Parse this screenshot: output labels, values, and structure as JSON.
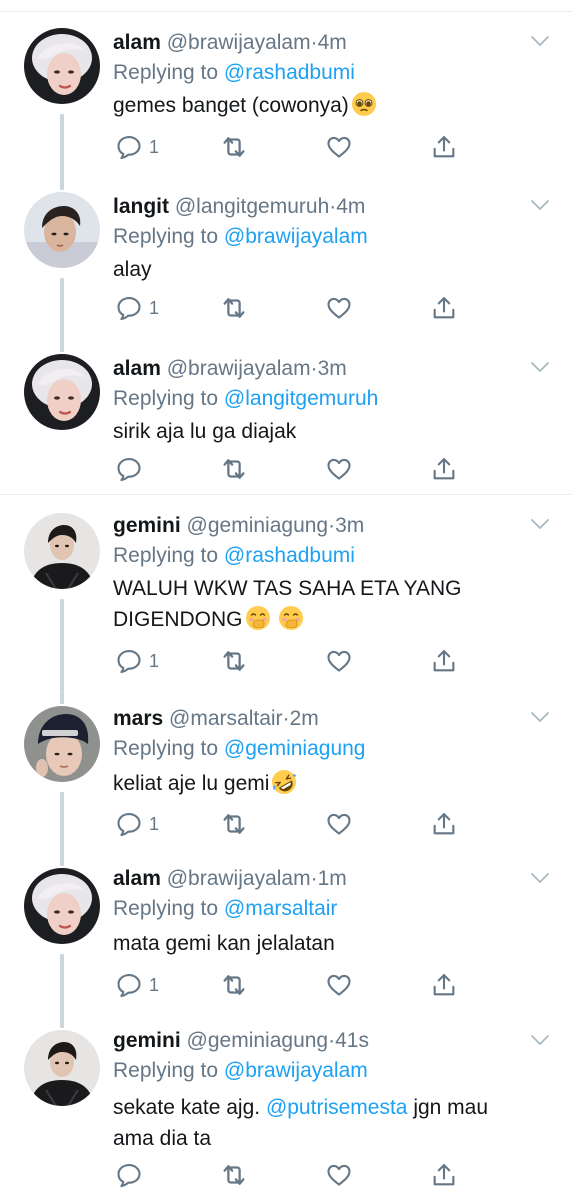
{
  "colors": {
    "link": "#1da1f2",
    "muted": "#657786",
    "text": "#14171a",
    "thread_line": "#ccd6dd",
    "divider": "#e6ecf0"
  },
  "labels": {
    "replying_to": "Replying to"
  },
  "tweets": [
    {
      "name": "alam",
      "handle": "@brawijayalam",
      "sep": "·",
      "time": "4m",
      "reply_to": "@rashadbumi",
      "text": "gemes banget (cowonya)",
      "emoji": "pleading-face-emoji",
      "reply_count": "1"
    },
    {
      "name": "langit",
      "handle": "@langitgemuruh",
      "sep": "·",
      "time": "4m",
      "reply_to": "@brawijayalam",
      "text": "alay",
      "reply_count": "1"
    },
    {
      "name": "alam",
      "handle": "@brawijayalam",
      "sep": "·",
      "time": "3m",
      "reply_to": "@langitgemuruh",
      "text": "sirik aja lu ga diajak",
      "reply_count": ""
    },
    {
      "name": "gemini",
      "handle": "@geminiagung",
      "sep": "·",
      "time": "3m",
      "reply_to": "@rashadbumi",
      "text_line1": "WALUH WKW TAS SAHA ETA YANG",
      "text_line2": "DIGENDONG",
      "emoji": "hand-over-mouth-emoji",
      "reply_count": "1"
    },
    {
      "name": "mars",
      "handle": "@marsaltair",
      "sep": "·",
      "time": "2m",
      "reply_to": "@geminiagung",
      "text": "keliat aje lu gemi",
      "emoji": "rolling-on-floor-laughing-emoji",
      "reply_count": "1"
    },
    {
      "name": "alam",
      "handle": "@brawijayalam",
      "sep": "·",
      "time": "1m",
      "reply_to": "@marsaltair",
      "text": "mata gemi kan jelalatan",
      "reply_count": "1"
    },
    {
      "name": "gemini",
      "handle": "@geminiagung",
      "sep": "·",
      "time": "41s",
      "reply_to": "@brawijayalam",
      "text_pre": "sekate kate ajg.",
      "text_mention": "@putrisemesta",
      "text_post": "jgn mau",
      "text_line2": "ama dia ta",
      "reply_count": ""
    }
  ]
}
